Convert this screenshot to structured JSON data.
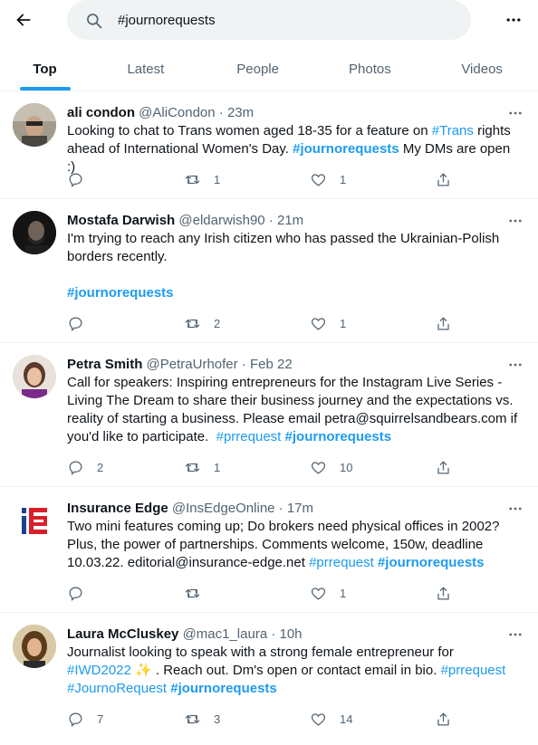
{
  "search": {
    "query": "#journorequests"
  },
  "tabs": [
    {
      "label": "Top"
    },
    {
      "label": "Latest"
    },
    {
      "label": "People"
    },
    {
      "label": "Photos"
    },
    {
      "label": "Videos"
    }
  ],
  "icons": {
    "back": "arrow-left-icon",
    "search": "search-icon",
    "more": "more-horizontal-icon",
    "reply": "reply-icon",
    "retweet": "retweet-icon",
    "like": "heart-icon",
    "share": "share-icon"
  },
  "colors": {
    "accent": "#1d9bf0",
    "text": "#0f1419",
    "muted": "#536471"
  },
  "tweets": [
    {
      "name": "ali condon",
      "meta": "@AliCondon · 23m",
      "lines": [
        [
          "Looking to chat to Trans women aged 18-35 for a feature on ",
          "#Trans",
          " rights"
        ],
        [
          "ahead of International Women's Day. ",
          "#journorequests",
          " My DMs are open :)"
        ]
      ],
      "replies": "",
      "retweets": "1",
      "likes": "1"
    },
    {
      "name": "Mostafa Darwish",
      "meta": "@eldarwish90 · 21m",
      "lines": [
        [
          "I'm trying to reach any Irish citizen who has passed the Ukrainian-Polish"
        ],
        [
          "borders recently."
        ],
        [
          "#journorequests"
        ]
      ],
      "replies": "",
      "retweets": "2",
      "likes": "1"
    },
    {
      "name": "Petra Smith",
      "meta": "@PetraUrhofer · Feb 22",
      "lines": [
        [
          "Call for speakers: Inspiring entrepreneurs for the Instagram Live Series -"
        ],
        [
          "Living The Dream to share their business journey and the expectations vs."
        ],
        [
          "reality of starting a business. Please email petra@squirrelsandbears.com if"
        ],
        [
          "you'd like to participate.  ",
          "#prrequest",
          " ",
          "#journorequests"
        ]
      ],
      "replies": "2",
      "retweets": "1",
      "likes": "10"
    },
    {
      "name": "Insurance Edge",
      "meta": "@InsEdgeOnline · 17m",
      "avatar_text": "iE",
      "lines": [
        [
          "Two mini features coming up; Do brokers need physical offices in 2002?"
        ],
        [
          "Plus, the power of partnerships. Comments welcome, 150w, deadline"
        ],
        [
          "10.03.22. editorial@insurance-edge.net ",
          "#prrequest",
          " ",
          "#journorequests"
        ]
      ],
      "replies": "",
      "retweets": "",
      "likes": "1"
    },
    {
      "name": "Laura McCluskey",
      "meta": "@mac1_laura · 10h",
      "lines": [
        [
          "Journalist looking to speak with a strong female entrepreneur for"
        ],
        [
          "#IWD2022",
          " ✨ . Reach out. Dm's open or contact email in bio. ",
          "#prrequest"
        ],
        [
          "#JournoRequest",
          " ",
          "#journorequests"
        ]
      ],
      "replies": "7",
      "retweets": "3",
      "likes": "14"
    }
  ]
}
